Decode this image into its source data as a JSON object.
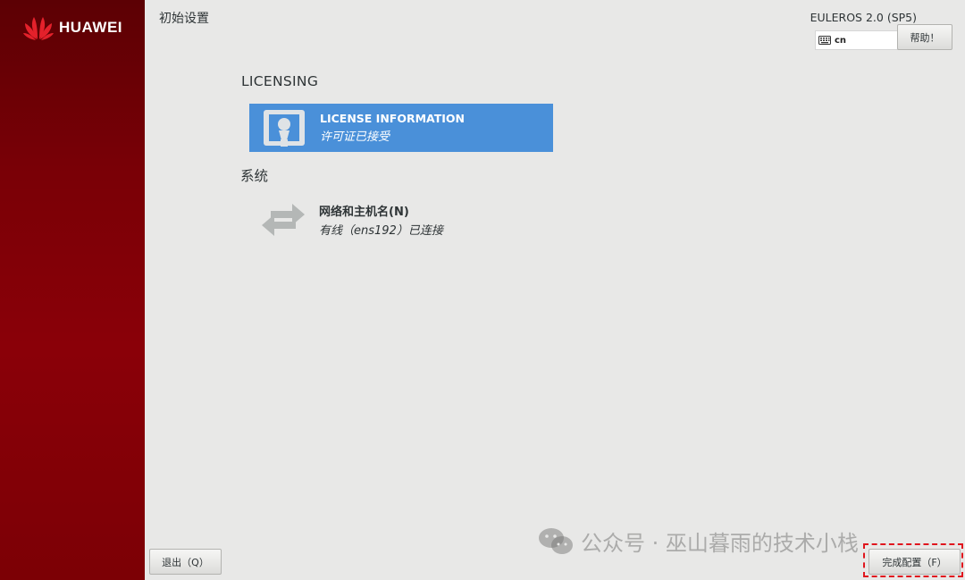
{
  "brand": {
    "logo_text": "HUAWEI",
    "colors": {
      "sidebar": "#7a0006",
      "accent": "#4a90d9",
      "logo_red": "#e4212b"
    }
  },
  "header": {
    "page_title": "初始设置",
    "os_name": "EULEROS 2.0 (SP5)",
    "keyboard_layout": "cn",
    "keyboard_icon": "keyboard-icon",
    "help_label": "帮助！"
  },
  "sections": {
    "licensing": {
      "title": "LICENSING",
      "spoke": {
        "icon": "license-icon",
        "name": "LICENSE INFORMATION",
        "status": "许可证已接受"
      }
    },
    "system": {
      "title": "系统",
      "spoke": {
        "icon": "network-arrows-icon",
        "name": "网络和主机名(N)",
        "status": "有线（ens192）已连接"
      }
    }
  },
  "footer": {
    "quit_label": "退出（Q）",
    "finish_label": "完成配置（F）"
  },
  "watermark": {
    "icon": "wechat-icon",
    "text": "公众号 · 巫山暮雨的技术小栈"
  }
}
